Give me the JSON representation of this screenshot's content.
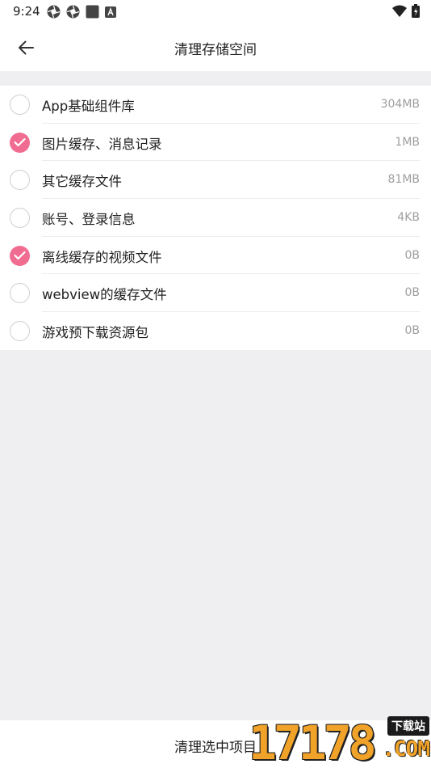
{
  "status_bar": {
    "time": "9:24",
    "left_icons": [
      "shutter-icon",
      "shutter-icon",
      "square-icon",
      "a-icon"
    ],
    "right_icons": [
      "wifi-icon",
      "battery-icon"
    ]
  },
  "app_bar": {
    "back_icon": "arrow-left-icon",
    "title": "清理存储空间"
  },
  "items": [
    {
      "label": "App基础组件库",
      "size": "304MB",
      "checked": false
    },
    {
      "label": "图片缓存、消息记录",
      "size": "1MB",
      "checked": true
    },
    {
      "label": "其它缓存文件",
      "size": "81MB",
      "checked": false
    },
    {
      "label": "账号、登录信息",
      "size": "4KB",
      "checked": false
    },
    {
      "label": "离线缓存的视频文件",
      "size": "0B",
      "checked": true
    },
    {
      "label": "webview的缓存文件",
      "size": "0B",
      "checked": false
    },
    {
      "label": "游戏预下载资源包",
      "size": "0B",
      "checked": false
    }
  ],
  "bottom": {
    "button_label": "清理选中项目"
  },
  "watermark": {
    "digits": "17178",
    "tag": "下载站",
    "domain": ".COM"
  },
  "colors": {
    "accent": "#f16c91",
    "background": "#efeff1",
    "watermark": "#f0a229"
  }
}
